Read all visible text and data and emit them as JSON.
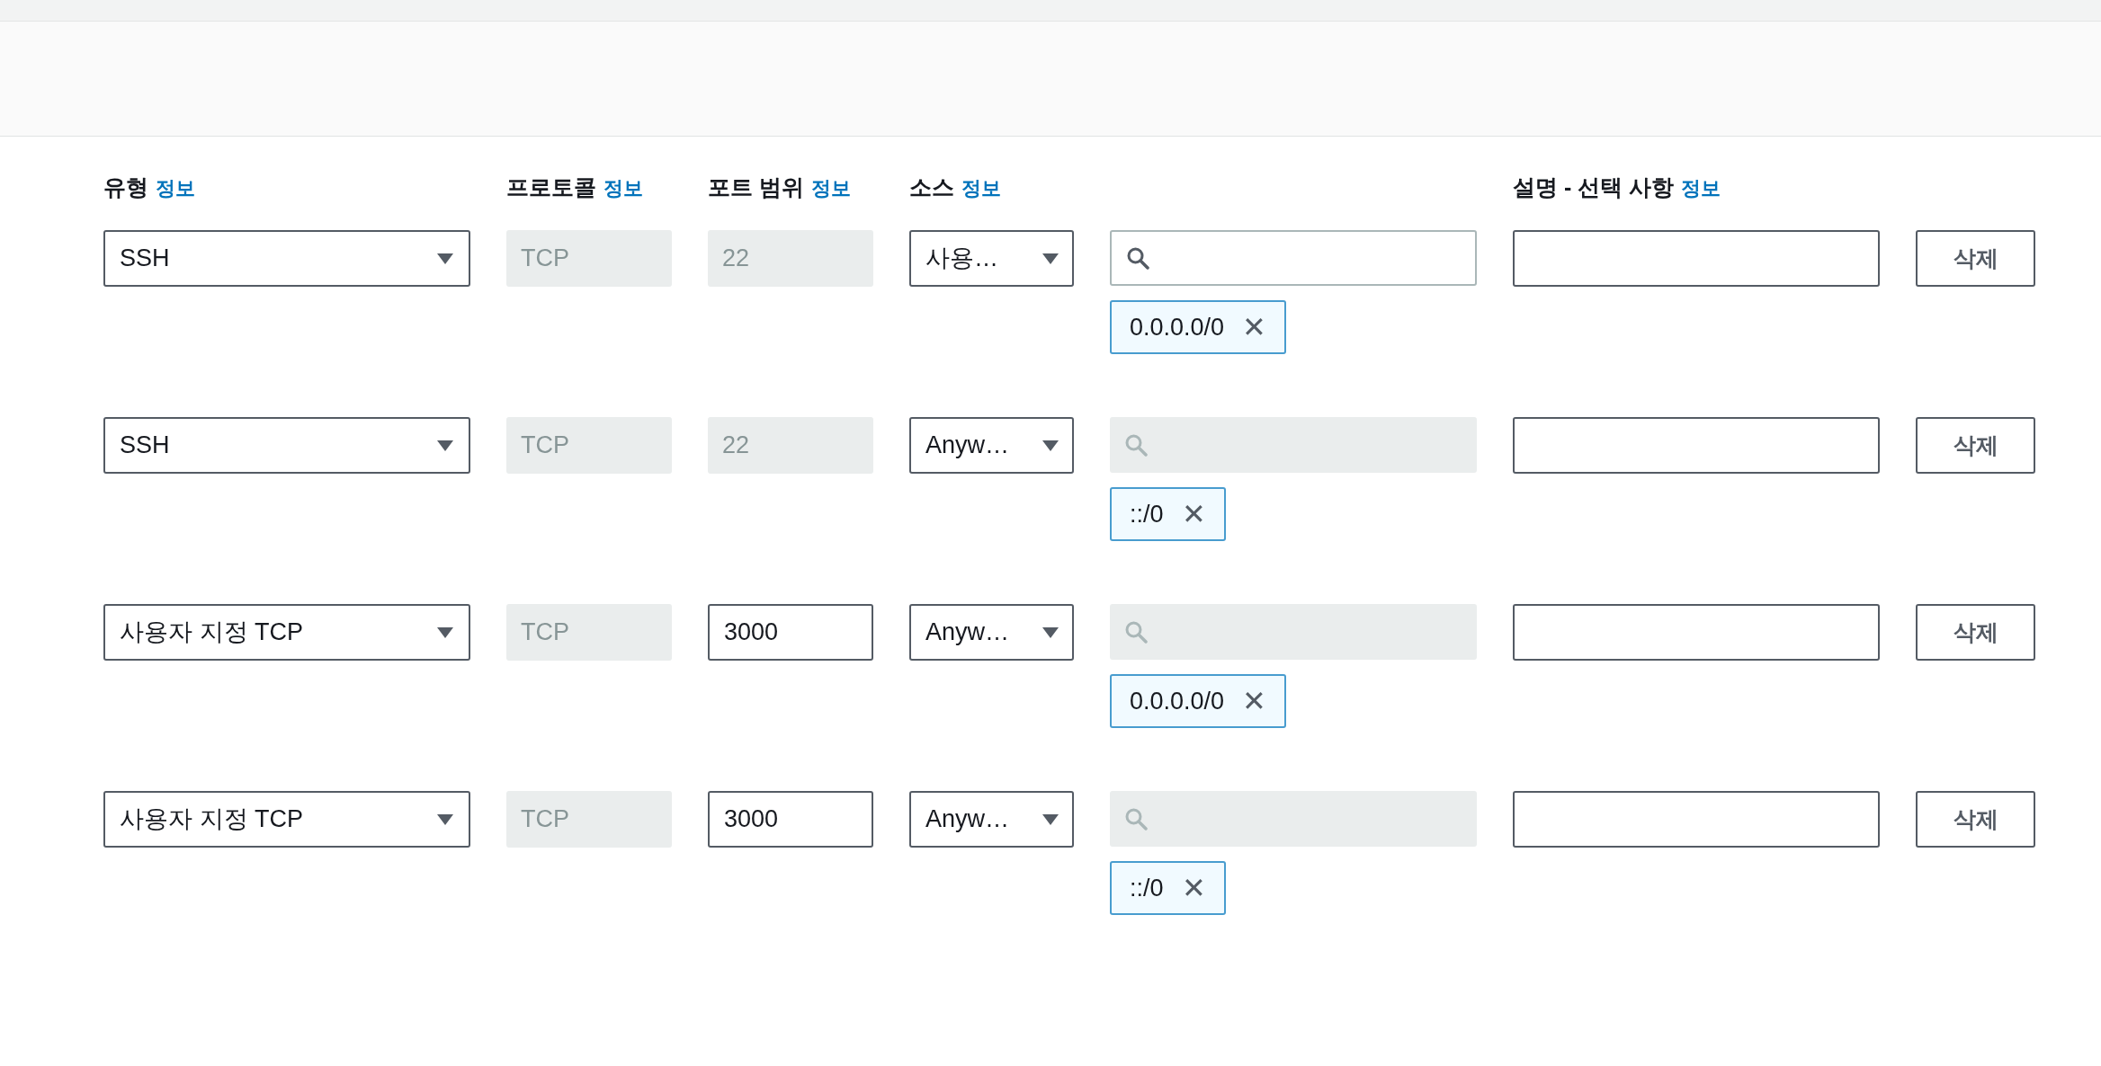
{
  "headers": [
    {
      "label": "유형",
      "info": "정보"
    },
    {
      "label": "프로토콜",
      "info": "정보"
    },
    {
      "label": "포트 범위",
      "info": "정보"
    },
    {
      "label": "소스",
      "info": "정보"
    },
    {
      "label": "설명 - 선택 사항",
      "info": "정보"
    }
  ],
  "rules": [
    {
      "type": "SSH",
      "protocol": "TCP",
      "port": "22",
      "port_disabled": true,
      "source": "사용…",
      "search_disabled": false,
      "cidr": "0.0.0.0/0",
      "remove": "✕",
      "delete": "삭제"
    },
    {
      "type": "SSH",
      "protocol": "TCP",
      "port": "22",
      "port_disabled": true,
      "source": "Anyw…",
      "search_disabled": true,
      "cidr": "::/0",
      "remove": "✕",
      "delete": "삭제"
    },
    {
      "type": "사용자 지정 TCP",
      "protocol": "TCP",
      "port": "3000",
      "port_disabled": false,
      "source": "Anyw…",
      "search_disabled": true,
      "cidr": "0.0.0.0/0",
      "remove": "✕",
      "delete": "삭제"
    },
    {
      "type": "사용자 지정 TCP",
      "protocol": "TCP",
      "port": "3000",
      "port_disabled": false,
      "source": "Anyw…",
      "search_disabled": true,
      "cidr": "::/0",
      "remove": "✕",
      "delete": "삭제"
    }
  ]
}
